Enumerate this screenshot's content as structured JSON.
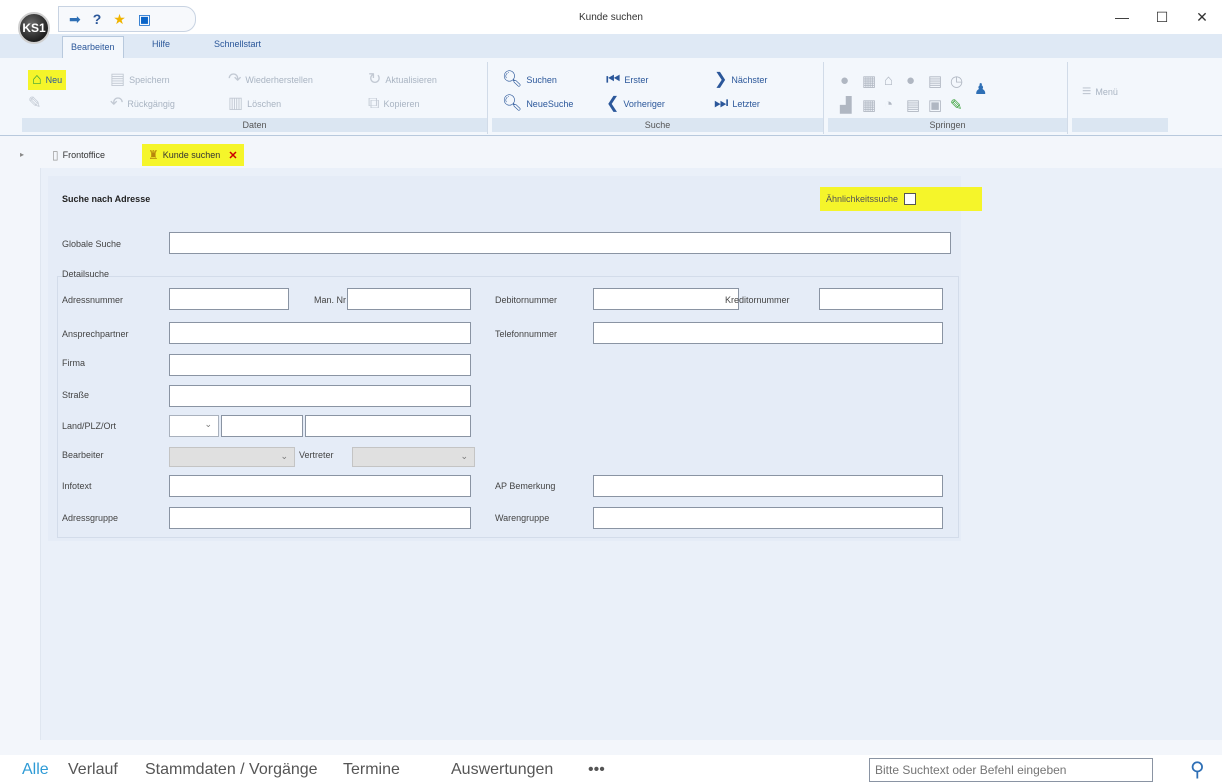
{
  "window": {
    "title": "Kunde suchen",
    "logo_text": "KS1"
  },
  "ribbon_tabs": [
    "Bearbeiten",
    "Hilfe",
    "Schnellstart"
  ],
  "ribbon": {
    "group_daten": "Daten",
    "group_suche": "Suche",
    "group_springen": "Springen",
    "neu": "Neu",
    "speichern": "Speichern",
    "wiederherstellen": "Wiederherstellen",
    "aktualisieren": "Aktualisieren",
    "rueckgaengig": "Rückgängig",
    "loeschen": "Löschen",
    "kopieren": "Kopieren",
    "suchen": "Suchen",
    "neue_suche": "NeueSuche",
    "erster": "Erster",
    "vorheriger": "Vorheriger",
    "naechster": "Nächster",
    "letzter": "Letzter",
    "menu": "Menü"
  },
  "doc_tabs": {
    "frontoffice": "Frontoffice",
    "kunde_suchen": "Kunde suchen"
  },
  "form": {
    "title": "Suche nach Adresse",
    "similarity": "Ähnlichkeitssuche",
    "global_search": "Globale Suche",
    "detail_search": "Detailsuche",
    "adressnummer": "Adressnummer",
    "man_nr": "Man. Nr",
    "debitornummer": "Debitornummer",
    "kreditornummer": "Kreditornummer",
    "ansprechpartner": "Ansprechpartner",
    "telefonnummer": "Telefonnummer",
    "firma": "Firma",
    "strasse": "Straße",
    "land_plz_ort": "Land/PLZ/Ort",
    "bearbeiter": "Bearbeiter",
    "vertreter": "Vertreter",
    "infotext": "Infotext",
    "ap_bemerkung": "AP Bemerkung",
    "adressgruppe": "Adressgruppe",
    "warengruppe": "Warengruppe"
  },
  "bottom_nav": [
    "Alle",
    "Verlauf",
    "Stammdaten / Vorgänge",
    "Termine",
    "Auswertungen",
    "•••"
  ],
  "command_search": {
    "placeholder": "Bitte Suchtext oder Befehl eingeben"
  },
  "colors": {
    "highlight": "#f5f52a",
    "accent": "#2b579a",
    "nav_active": "#2e9bd6"
  }
}
